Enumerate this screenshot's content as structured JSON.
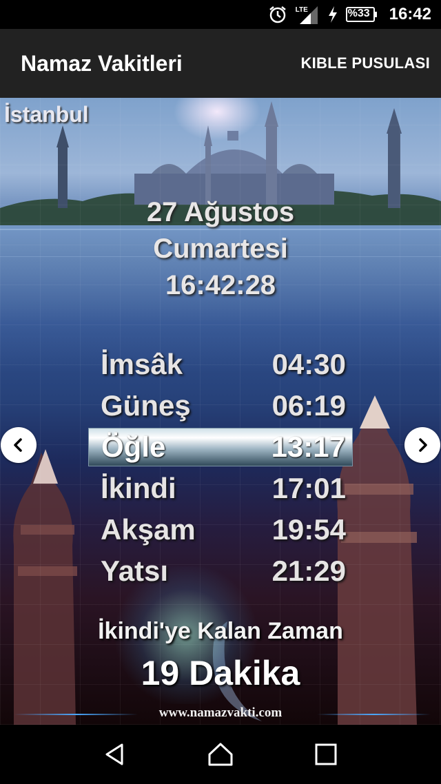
{
  "status_bar": {
    "time": "16:42",
    "network": "LTE",
    "battery": "%33",
    "icons": [
      "alarm-icon",
      "signal-icon",
      "charging-icon",
      "battery-icon"
    ]
  },
  "app_bar": {
    "title": "Namaz Vakitleri",
    "action": "KIBLE PUSULASI"
  },
  "location": {
    "city": "İstanbul"
  },
  "date": {
    "day_month": "27 Ağustos",
    "weekday": "Cumartesi",
    "clock": "16:42:28"
  },
  "prayer_times": [
    {
      "name": "İmsâk",
      "time": "04:30",
      "active": false
    },
    {
      "name": "Güneş",
      "time": "06:19",
      "active": false
    },
    {
      "name": "Öğle",
      "time": "13:17",
      "active": true
    },
    {
      "name": "İkindi",
      "time": "17:01",
      "active": false
    },
    {
      "name": "Akşam",
      "time": "19:54",
      "active": false
    },
    {
      "name": "Yatsı",
      "time": "21:29",
      "active": false
    }
  ],
  "countdown": {
    "label": "İkindi'ye Kalan Zaman",
    "value": "19 Dakika"
  },
  "footer": {
    "website": "www.namazvakti.com"
  },
  "colors": {
    "app_bar": "#222222",
    "active_row_highlight": "#9fb6c4",
    "text": "#e6e4e4"
  }
}
